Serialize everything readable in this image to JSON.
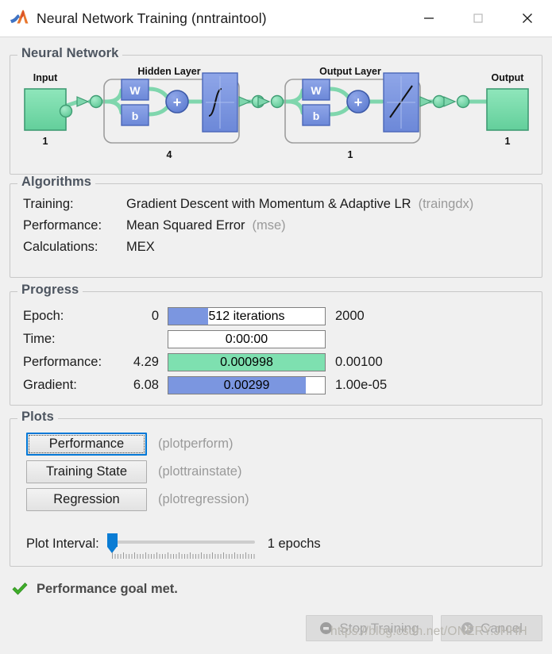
{
  "window": {
    "title": "Neural Network Training (nntraintool)",
    "app_icon": "matlab-membrane-icon",
    "minimize_label": "—",
    "maximize_label": "□",
    "close_label": "✕"
  },
  "neural_network": {
    "legend": "Neural Network",
    "input": {
      "label": "Input",
      "size": "1"
    },
    "hidden_layer": {
      "label": "Hidden Layer",
      "size": "4",
      "weight": "W",
      "bias": "b",
      "sum": "+",
      "transfer": "sigmoid"
    },
    "output_layer": {
      "label": "Output Layer",
      "size": "1",
      "weight": "W",
      "bias": "b",
      "sum": "+",
      "transfer": "linear"
    },
    "output": {
      "label": "Output",
      "size": "1"
    }
  },
  "algorithms": {
    "legend": "Algorithms",
    "rows": [
      {
        "label": "Training:",
        "value": "Gradient Descent with Momentum & Adaptive LR",
        "fn": "(traingdx)"
      },
      {
        "label": "Performance:",
        "value": "Mean Squared Error",
        "fn": "(mse)"
      },
      {
        "label": "Calculations:",
        "value": "MEX",
        "fn": ""
      }
    ]
  },
  "progress": {
    "legend": "Progress",
    "rows": [
      {
        "label": "Epoch:",
        "start": "0",
        "bar_text": "512 iterations",
        "end": "2000",
        "fill_percent": 25.6,
        "bar_color": "blue"
      },
      {
        "label": "Time:",
        "start": "",
        "bar_text": "0:00:00",
        "end": "",
        "fill_percent": 0,
        "bar_color": "blue"
      },
      {
        "label": "Performance:",
        "start": "4.29",
        "bar_text": "0.000998",
        "end": "0.00100",
        "fill_percent": 100,
        "bar_color": "green"
      },
      {
        "label": "Gradient:",
        "start": "6.08",
        "bar_text": "0.00299",
        "end": "1.00e-05",
        "fill_percent": 88,
        "bar_color": "blue"
      }
    ]
  },
  "plots": {
    "legend": "Plots",
    "buttons": [
      {
        "label": "Performance",
        "fn": "(plotperform)",
        "focused": true
      },
      {
        "label": "Training State",
        "fn": "(plottrainstate)",
        "focused": false
      },
      {
        "label": "Regression",
        "fn": "(plotregression)",
        "focused": false
      }
    ],
    "interval_label": "Plot Interval:",
    "interval_value": "1 epochs",
    "slider_percent": 0
  },
  "status": {
    "icon": "green-check-icon",
    "text": "Performance goal met."
  },
  "actions": [
    {
      "name": "stop-training",
      "label": "Stop Training",
      "icon": "stop-icon",
      "disabled": true
    },
    {
      "name": "cancel",
      "label": "Cancel",
      "icon": "cancel-icon",
      "disabled": true
    }
  ],
  "watermark": {
    "text": "https://blog.csdn.net/ONERY.JHHH"
  },
  "colors": {
    "bar_blue": "#7b96e0",
    "bar_green": "#7ee0b0",
    "node_green": "#7ddbaa",
    "block_blue": "#7b96e0",
    "focus_blue": "#0078d7",
    "slider_blue": "#0a7cd4",
    "check_green": "#3fae2a",
    "panel_bg": "#f0f0f0"
  }
}
